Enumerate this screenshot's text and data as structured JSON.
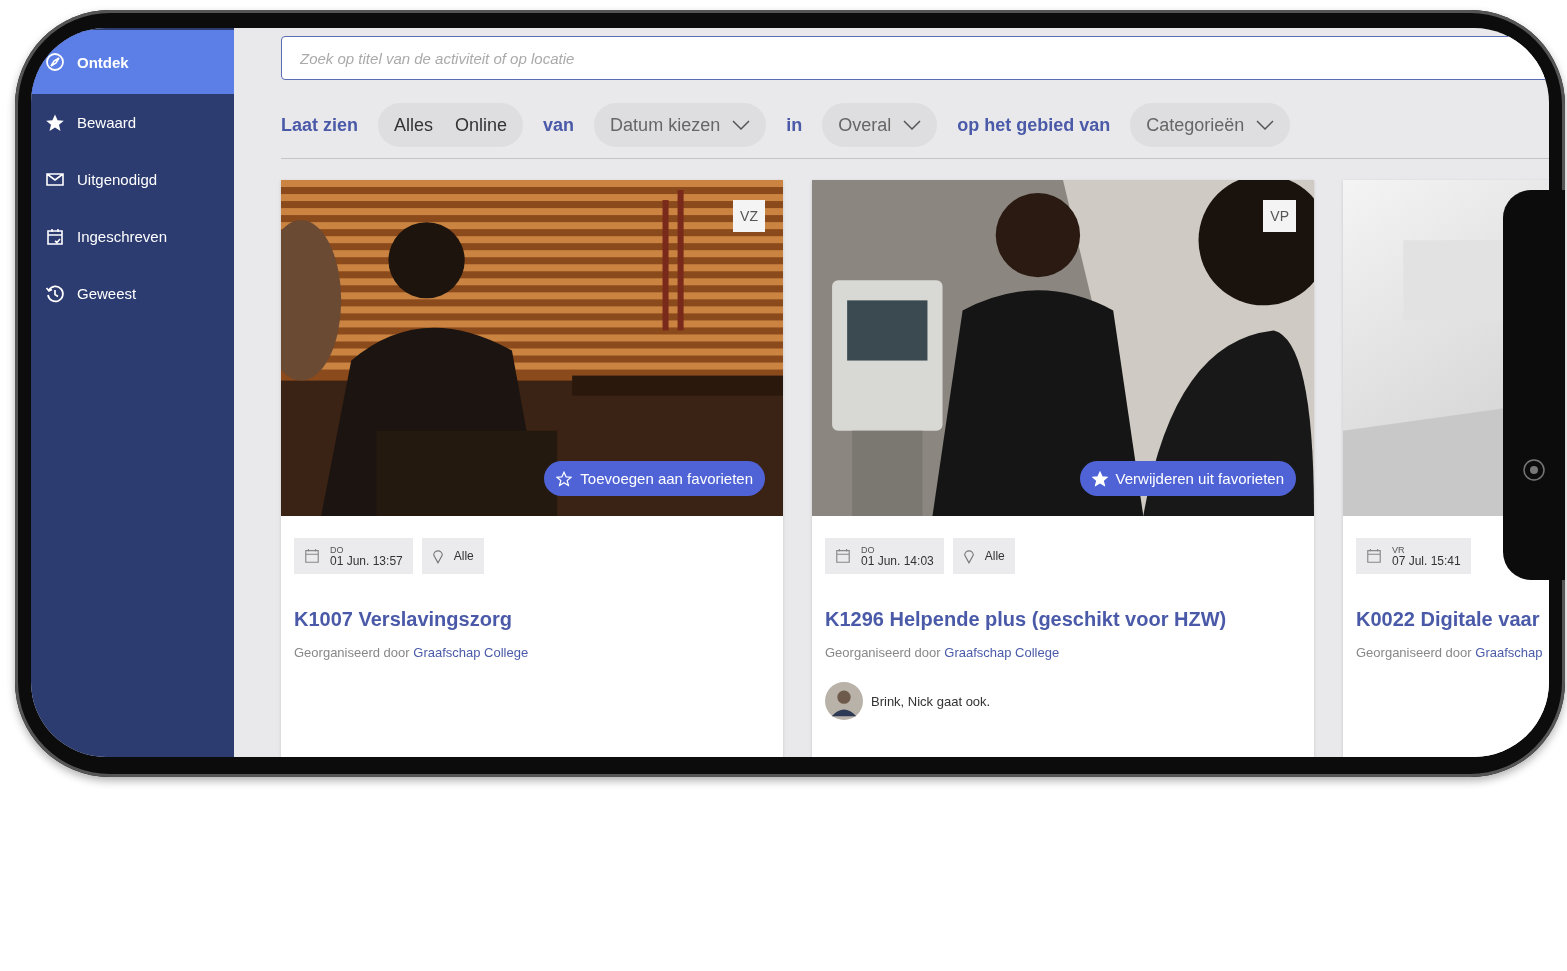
{
  "sidebar": {
    "items": [
      {
        "label": "Ontdek",
        "selected": true
      },
      {
        "label": "Bewaard",
        "selected": false
      },
      {
        "label": "Uitgenodigd",
        "selected": false
      },
      {
        "label": "Ingeschreven",
        "selected": false
      },
      {
        "label": "Geweest",
        "selected": false
      }
    ]
  },
  "search": {
    "placeholder": "Zoek op titel van de activiteit of op locatie"
  },
  "filters": [
    {
      "kind": "label",
      "text": "Laat zien"
    },
    {
      "kind": "toggle",
      "options": [
        "Alles",
        "Online"
      ]
    },
    {
      "kind": "label",
      "text": "van"
    },
    {
      "kind": "dropdown",
      "text": "Datum kiezen"
    },
    {
      "kind": "label",
      "text": "in"
    },
    {
      "kind": "dropdown",
      "text": "Overal"
    },
    {
      "kind": "label",
      "text": "op het gebied van"
    },
    {
      "kind": "dropdown",
      "text": "Categorieën"
    }
  ],
  "cards": [
    {
      "badge": "VZ",
      "favorite": {
        "label": "Toevoegen aan favorieten",
        "favorited": false
      },
      "day": "DO",
      "date": "01 Jun. 13:57",
      "location": "Alle",
      "title": "K1007 Verslavingszorg",
      "organizer_prefix": "Georganiseerd door",
      "organizer": "Graafschap College"
    },
    {
      "badge": "VP",
      "favorite": {
        "label": "Verwijderen uit favorieten",
        "favorited": true
      },
      "day": "DO",
      "date": "01 Jun. 14:03",
      "location": "Alle",
      "title": "K1296 Helpende plus (geschikt voor HZW)",
      "organizer_prefix": "Georganiseerd door",
      "organizer": "Graafschap College",
      "attendee": "Brink, Nick gaat ook."
    },
    {
      "day": "VR",
      "date": "07 Jul. 15:41",
      "title": "K0022 Digitale vaar",
      "organizer_prefix": "Georganiseerd door",
      "organizer": "Graafschap"
    }
  ]
}
